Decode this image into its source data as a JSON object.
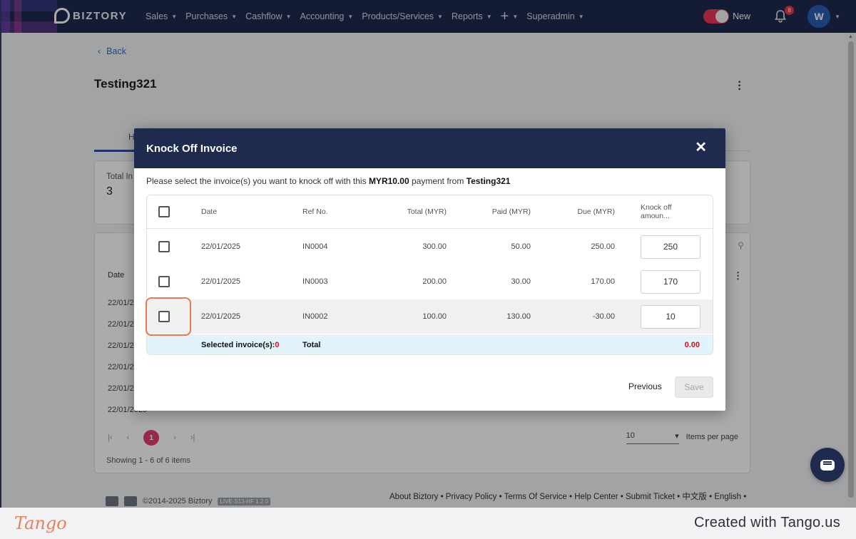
{
  "nav": {
    "brand": "BIZTORY",
    "menu": [
      "Sales",
      "Purchases",
      "Cashflow",
      "Accounting",
      "Products/Services",
      "Reports",
      "",
      "Superadmin"
    ],
    "toggle_label": "New",
    "notification_count": "8",
    "avatar_initial": "W"
  },
  "page": {
    "back_label": "Back",
    "title": "Testing321",
    "tab_fragment": "H",
    "total_label": "Total In",
    "total_value": "3",
    "table_date_header": "Date",
    "bg_rows": [
      "22/01/2",
      "22/01/2",
      "22/01/2",
      "22/01/2",
      "22/01/2",
      "22/01/2025"
    ],
    "page_current": "1",
    "per_page_value": "10",
    "per_page_label": "Items per page",
    "showing": "Showing 1 - 6 of 6 items",
    "footer_links": "About Biztory • Privacy Policy • Terms Of Service • Help Center • Submit Ticket • 中文版 • English •",
    "copyright": "©2014-2025 Biztory",
    "version": "LIVE-S13-HF 1.2.0"
  },
  "modal": {
    "title": "Knock Off Invoice",
    "message_prefix": "Please select the invoice(s) you want to knock off with this ",
    "message_amount": "MYR10.00",
    "message_middle": " payment from ",
    "message_customer": "Testing321",
    "headers": {
      "date": "Date",
      "ref": "Ref No.",
      "total": "Total (MYR)",
      "paid": "Paid (MYR)",
      "due": "Due (MYR)",
      "knock_off": "Knock off amoun..."
    },
    "rows": [
      {
        "date": "22/01/2025",
        "ref": "IN0004",
        "total": "300.00",
        "paid": "50.00",
        "due": "250.00",
        "knock_off": "250"
      },
      {
        "date": "22/01/2025",
        "ref": "IN0003",
        "total": "200.00",
        "paid": "30.00",
        "due": "170.00",
        "knock_off": "170"
      },
      {
        "date": "22/01/2025",
        "ref": "IN0002",
        "total": "100.00",
        "paid": "130.00",
        "due": "-30.00",
        "knock_off": "10"
      }
    ],
    "selected_label": "Selected invoice(s): ",
    "selected_count": "0",
    "total_label": "Total",
    "total_amount": "0.00",
    "previous_label": "Previous",
    "save_label": "Save"
  },
  "tango": {
    "logo": "Tango",
    "credit": "Created with Tango.us"
  },
  "colors": {
    "navbar": "#1f2a4f",
    "accent_red": "#d0141b",
    "highlight": "#ea7a4e",
    "totals_row": "#e2f3fb"
  }
}
